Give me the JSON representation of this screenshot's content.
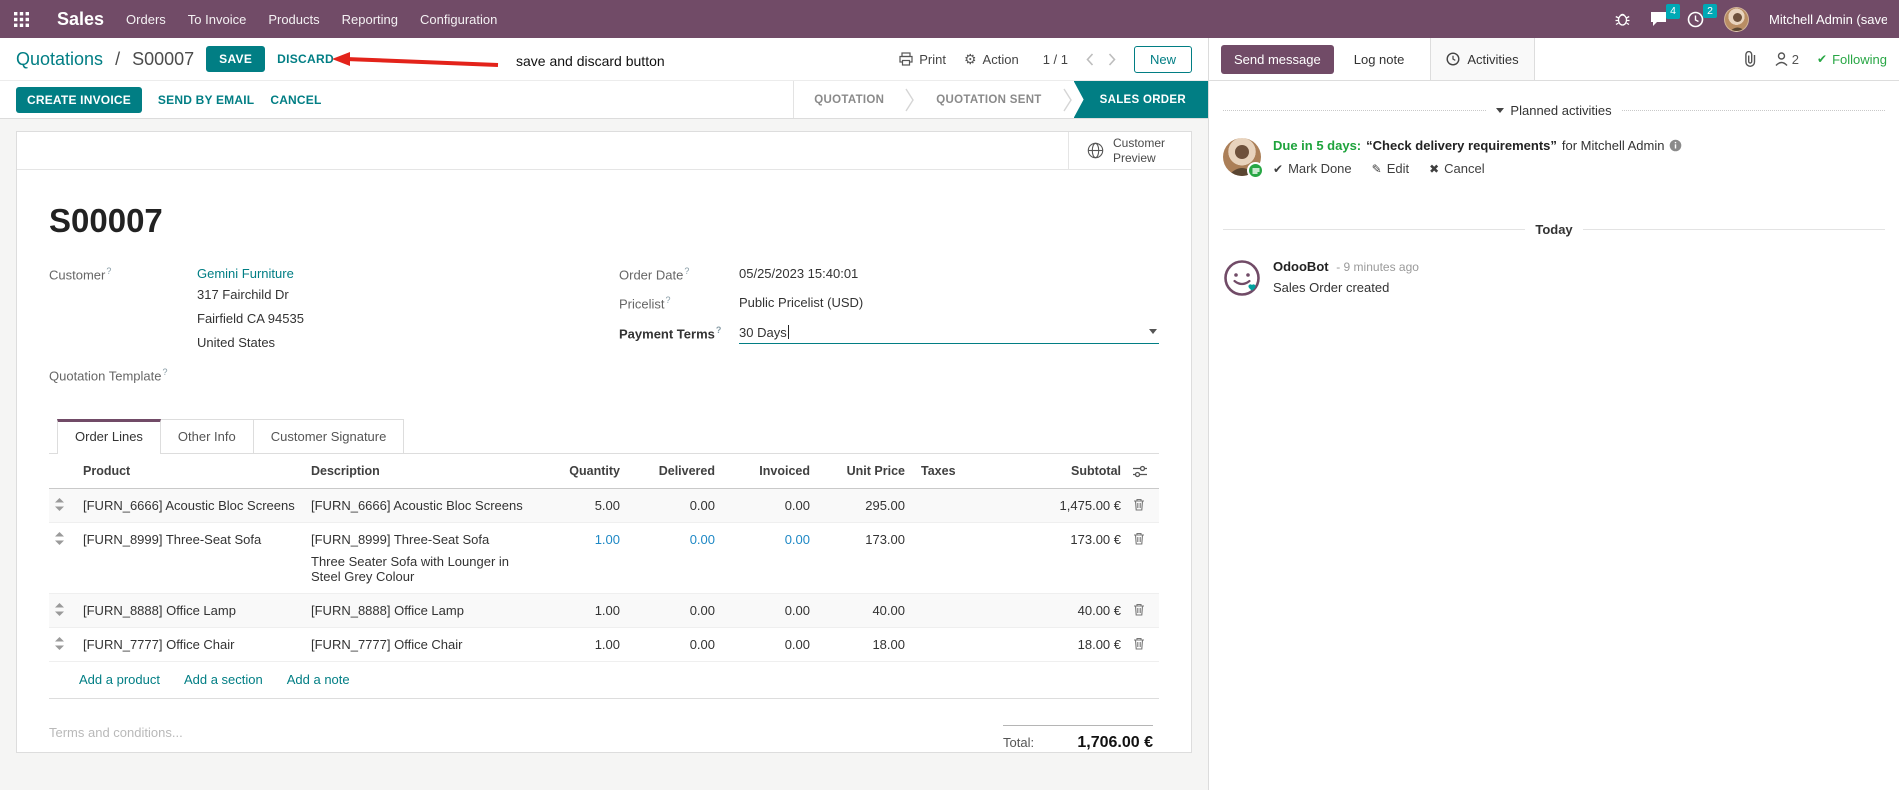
{
  "colors": {
    "navbar_bg": "#714B67",
    "accent_teal": "#017E84",
    "badge_teal": "#00A9B5",
    "success_green": "#28a745",
    "modified_blue": "#1E88C5",
    "annotation_red": "#E3231A"
  },
  "navbar": {
    "app_name": "Sales",
    "menus": [
      "Orders",
      "To Invoice",
      "Products",
      "Reporting",
      "Configuration"
    ],
    "messages_badge": "4",
    "activities_badge": "2",
    "user_name": "Mitchell Admin (save_discar"
  },
  "control_panel": {
    "breadcrumb_parent": "Quotations",
    "separator": "/",
    "breadcrumb_current": "S00007",
    "save_label": "SAVE",
    "discard_label": "DISCARD",
    "annotation": "save and discard button",
    "print_label": "Print",
    "action_label": "Action",
    "gear_glyph": "⚙",
    "pager": "1 / 1",
    "new_label": "New"
  },
  "statusbar": {
    "buttons": [
      "CREATE INVOICE",
      "SEND BY EMAIL",
      "CANCEL"
    ],
    "stages": [
      {
        "label": "QUOTATION",
        "active": false
      },
      {
        "label": "QUOTATION SENT",
        "active": false
      },
      {
        "label": "SALES ORDER",
        "active": true
      }
    ]
  },
  "sheet": {
    "preview_button": "Customer Preview",
    "title": "S00007",
    "help_marker": "?",
    "fields": {
      "customer_label": "Customer",
      "customer_name": "Gemini Furniture",
      "customer_address": [
        "317 Fairchild Dr",
        "Fairfield CA 94535",
        "United States"
      ],
      "quotation_template_label": "Quotation Template",
      "order_date_label": "Order Date",
      "order_date": "05/25/2023 15:40:01",
      "pricelist_label": "Pricelist",
      "pricelist": "Public Pricelist (USD)",
      "payment_terms_label": "Payment Terms",
      "payment_terms": "30 Days"
    },
    "tabs": [
      {
        "label": "Order Lines",
        "active": true
      },
      {
        "label": "Other Info",
        "active": false
      },
      {
        "label": "Customer Signature",
        "active": false
      }
    ],
    "order_lines": {
      "columns": {
        "product": "Product",
        "description": "Description",
        "quantity": "Quantity",
        "delivered": "Delivered",
        "invoiced": "Invoiced",
        "unit_price": "Unit Price",
        "taxes": "Taxes",
        "subtotal": "Subtotal"
      },
      "rows": [
        {
          "product": "[FURN_6666] Acoustic Bloc Screens",
          "description": "[FURN_6666] Acoustic Bloc Screens",
          "description2": "",
          "quantity": "5.00",
          "delivered": "0.00",
          "invoiced": "0.00",
          "unit_price": "295.00",
          "taxes": "",
          "subtotal": "1,475.00 €"
        },
        {
          "product": "[FURN_8999] Three-Seat Sofa",
          "description": "[FURN_8999] Three-Seat Sofa",
          "description2": "Three Seater Sofa with Lounger in Steel Grey Colour",
          "quantity": "1.00",
          "delivered": "0.00",
          "invoiced": "0.00",
          "unit_price": "173.00",
          "taxes": "",
          "subtotal": "173.00 €"
        },
        {
          "product": "[FURN_8888] Office Lamp",
          "description": "[FURN_8888] Office Lamp",
          "description2": "",
          "quantity": "1.00",
          "delivered": "0.00",
          "invoiced": "0.00",
          "unit_price": "40.00",
          "taxes": "",
          "subtotal": "40.00 €"
        },
        {
          "product": "[FURN_7777] Office Chair",
          "description": "[FURN_7777] Office Chair",
          "description2": "",
          "quantity": "1.00",
          "delivered": "0.00",
          "invoiced": "0.00",
          "unit_price": "18.00",
          "taxes": "",
          "subtotal": "18.00 €"
        }
      ],
      "footer_links": [
        "Add a product",
        "Add a section",
        "Add a note"
      ]
    },
    "terms_placeholder": "Terms and conditions...",
    "total_label": "Total:",
    "total_value": "1,706.00 €"
  },
  "chatter": {
    "send_message": "Send message",
    "log_note": "Log note",
    "activities": "Activities",
    "followers_count": "2",
    "following": "Following",
    "planned_header": "Planned activities",
    "activity": {
      "due": "Due in 5 days:",
      "summary": "“Check delivery requirements”",
      "assignee": "for Mitchell Admin",
      "mark_done": "Mark Done",
      "edit": "Edit",
      "cancel": "Cancel",
      "check_glyph": "✔",
      "edit_glyph": "✎",
      "cancel_glyph": "✖"
    },
    "today": "Today",
    "message": {
      "author": "OdooBot",
      "time": "- 9 minutes ago",
      "body": "Sales Order created"
    }
  }
}
